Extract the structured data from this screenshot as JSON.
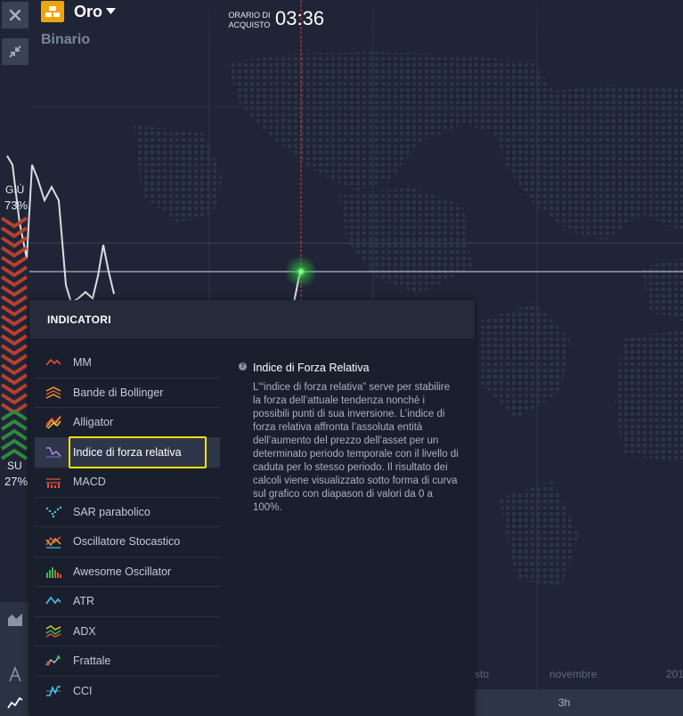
{
  "header": {
    "asset_name": "Oro",
    "asset_mode": "Binario",
    "purchase_time_label": "ORARIO DI ACQUISTO",
    "purchase_time": "03:36"
  },
  "sentiment": {
    "down_label": "GIÙ",
    "down_pct": "73%",
    "up_label": "SU",
    "up_pct": "27%"
  },
  "timeline": {
    "labels": [
      "sto",
      "novembre",
      "201"
    ],
    "timeframe": "3h"
  },
  "indicators_panel": {
    "title": "INDICATORI",
    "items": [
      {
        "label": "MM",
        "icon": "moving-average-icon"
      },
      {
        "label": "Bande di Bollinger",
        "icon": "bollinger-bands-icon"
      },
      {
        "label": "Alligator",
        "icon": "alligator-icon"
      },
      {
        "label": "Indice di forza relativa",
        "icon": "rsi-icon"
      },
      {
        "label": "MACD",
        "icon": "macd-icon"
      },
      {
        "label": "SAR parabolico",
        "icon": "parabolic-sar-icon"
      },
      {
        "label": "Oscillatore Stocastico",
        "icon": "stochastic-oscillator-icon"
      },
      {
        "label": "Awesome Oscillator",
        "icon": "awesome-oscillator-icon"
      },
      {
        "label": "ATR",
        "icon": "atr-icon"
      },
      {
        "label": "ADX",
        "icon": "adx-icon"
      },
      {
        "label": "Frattale",
        "icon": "fractal-icon"
      },
      {
        "label": "CCI",
        "icon": "cci-icon"
      }
    ],
    "selected_index": 3,
    "description_title": "Indice di Forza Relativa",
    "description_body": "L’“indice di forza relativa” serve per stabilire la forza dell’attuale tendenza nonchè i possibili punti di sua inversione. L’indice di forza relativa affronta l’assoluta entità dell’aumento del prezzo dell’asset per un determinato periodo temporale con il livello di caduta per lo stesso periodo. Il risultato dei calcoli viene visualizzato sotto forma di curva sul grafico con diapason di valori da 0 a 100%."
  },
  "colors": {
    "asset_badge": "#f0a30a",
    "price_line_marker": "#e23a3a",
    "highlight_box": "#f5e100",
    "down_arrows": "#b8402f",
    "up_arrows": "#2f8a3e"
  }
}
